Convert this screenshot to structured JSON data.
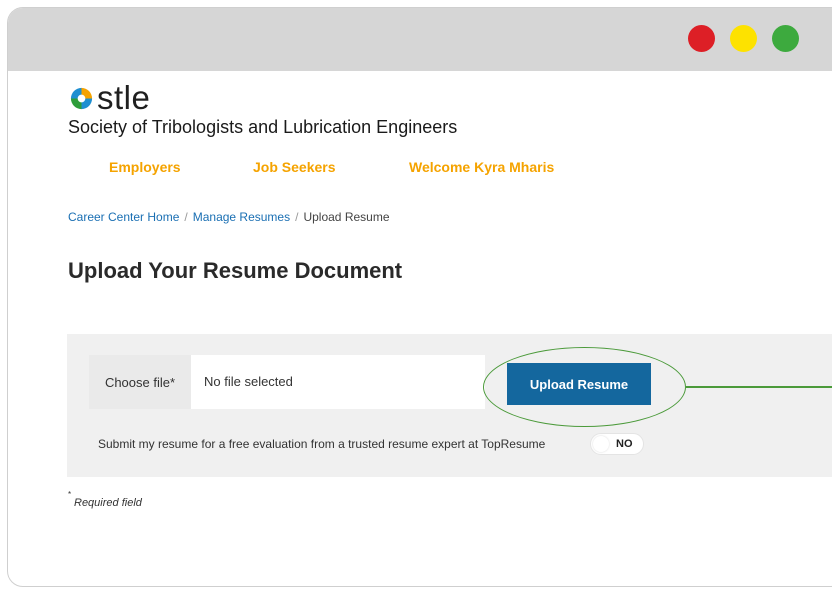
{
  "logo": {
    "text": "stle",
    "icon": "stle-logo-icon"
  },
  "org_name": "Society of Tribologists and Lubrication Engineers",
  "nav": [
    "Employers",
    "Job Seekers",
    "Welcome Kyra Mharis"
  ],
  "breadcrumb": {
    "items": [
      "Career Center Home",
      "Manage Resumes",
      "Upload Resume"
    ],
    "separator": "/"
  },
  "page_title": "Upload Your Resume Document",
  "upload_form": {
    "choose_file_label": "Choose file*",
    "file_status": "No file selected",
    "upload_button": "Upload Resume",
    "evaluation_text": "Submit my resume for a free evaluation from a trusted resume expert at TopResume",
    "evaluation_toggle": "NO"
  },
  "required_star": "*",
  "required_note": "Required field",
  "colors": {
    "nav_accent": "#f5a300",
    "link": "#1a6fb3",
    "primary_button": "#14679e",
    "highlight": "#4b9a3a",
    "window_dots": [
      "#dd1f26",
      "#fde200",
      "#3daa3e"
    ]
  }
}
